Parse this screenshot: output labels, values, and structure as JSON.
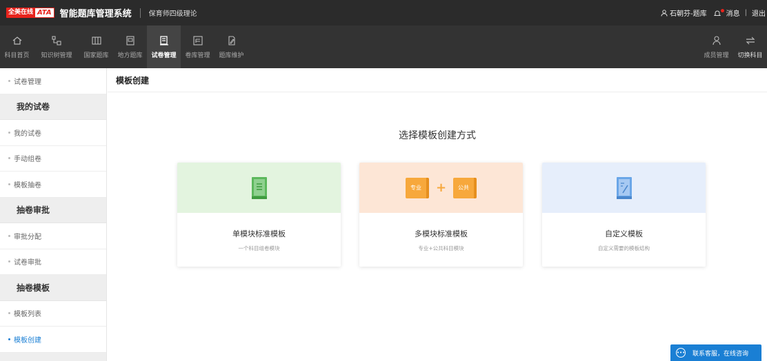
{
  "header": {
    "brand_cn": "全美在线",
    "brand_logo": "ATA",
    "system_title": "智能题库管理系统",
    "subject": "保育师四级理论",
    "user": "石朝芬-题库",
    "messages": "消息",
    "logout": "退出"
  },
  "nav": {
    "items": [
      {
        "label": "科目首页",
        "icon": "home-icon"
      },
      {
        "label": "知识树管理",
        "icon": "tree-icon"
      },
      {
        "label": "国家题库",
        "icon": "national-bank-icon"
      },
      {
        "label": "地方题库",
        "icon": "local-bank-icon"
      },
      {
        "label": "试卷管理",
        "icon": "paper-icon",
        "active": true
      },
      {
        "label": "卷库管理",
        "icon": "paper-bank-icon"
      },
      {
        "label": "题库维护",
        "icon": "maintenance-icon"
      }
    ],
    "right_items": [
      {
        "label": "成员管理",
        "icon": "members-icon"
      },
      {
        "label": "切换科目",
        "icon": "switch-icon"
      }
    ]
  },
  "sidebar": {
    "top_item": "试卷管理",
    "groups": [
      {
        "title": "我的试卷",
        "items": [
          "我的试卷",
          "手动组卷",
          "模板抽卷"
        ]
      },
      {
        "title": "抽卷审批",
        "items": [
          "审批分配",
          "试卷审批"
        ]
      },
      {
        "title": "抽卷模板",
        "items": [
          "模板列表",
          "模板创建"
        ]
      }
    ],
    "active_item": "模板创建"
  },
  "main": {
    "page_title": "模板创建",
    "heading": "选择模板创建方式",
    "cards": [
      {
        "title": "单模块标准模板",
        "desc": "一个科目组卷模块"
      },
      {
        "title": "多模块标准模板",
        "desc": "专业+公共科目模块",
        "tag_left": "专业",
        "tag_right": "公共"
      },
      {
        "title": "自定义模板",
        "desc": "自定义需要的模板结构"
      }
    ]
  },
  "chat": {
    "label": "联系客服，在线咨询"
  },
  "colors": {
    "topbar": "#2b2b2b",
    "navbar": "#333333",
    "brand_red": "#e8231c",
    "accent_blue": "#1a7fd4",
    "green_book": "#5cb85c",
    "orange_book": "#f7a83c",
    "blue_book": "#6aa6e8"
  }
}
